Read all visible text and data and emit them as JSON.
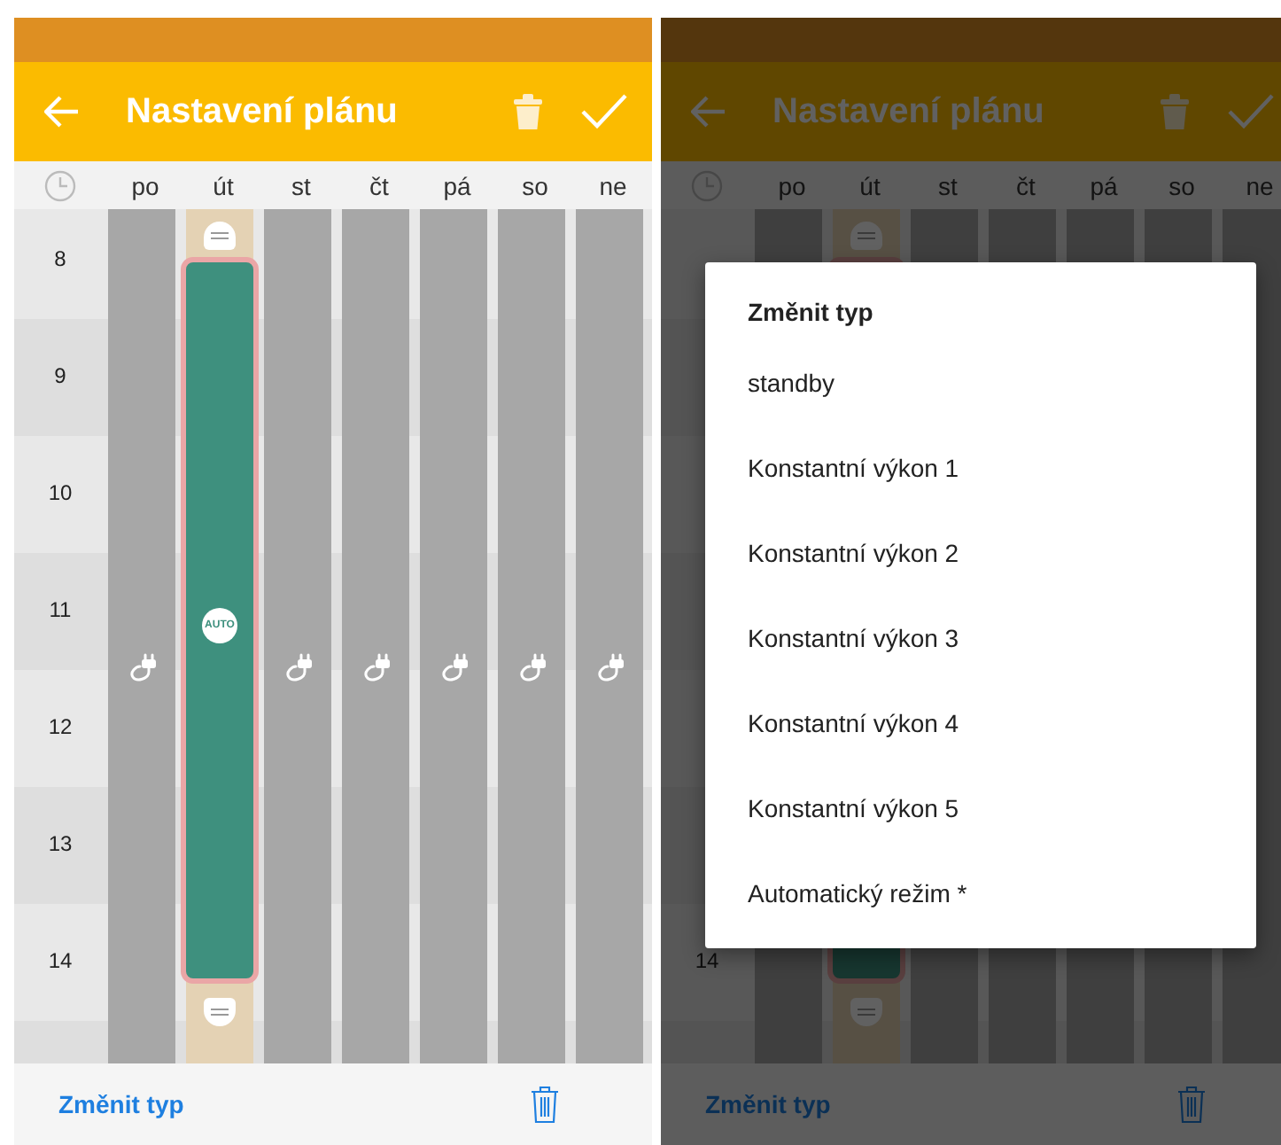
{
  "screens": [
    {
      "app_bar": {
        "title": "Nastavení plánu"
      },
      "days": [
        {
          "label": "po",
          "block": false
        },
        {
          "label": "út",
          "block": true
        },
        {
          "label": "st",
          "block": false
        },
        {
          "label": "čt",
          "block": false
        },
        {
          "label": "pá",
          "block": false
        },
        {
          "label": "so",
          "block": false
        },
        {
          "label": "ne",
          "block": false
        }
      ],
      "hours": [
        "8",
        "9",
        "10",
        "11",
        "12",
        "13",
        "14"
      ],
      "block_badge": "AUTO",
      "bottom_bar": {
        "action": "Změnit typ"
      },
      "dimmed": false
    },
    {
      "app_bar": {
        "title": "Nastavení plánu"
      },
      "days": [
        {
          "label": "po",
          "block": false
        },
        {
          "label": "út",
          "block": true
        },
        {
          "label": "st",
          "block": false
        },
        {
          "label": "čt",
          "block": false
        },
        {
          "label": "pá",
          "block": false
        },
        {
          "label": "so",
          "block": false
        },
        {
          "label": "ne",
          "block": false
        }
      ],
      "hours": [
        "14"
      ],
      "bottom_bar": {
        "action": "Změnit typ"
      },
      "dimmed": true,
      "dialog": {
        "title": "Změnit typ",
        "options": [
          "standby",
          "Konstantní výkon 1",
          "Konstantní výkon 2",
          "Konstantní výkon 3",
          "Konstantní výkon 4",
          "Konstantní výkon 5",
          "Automatický režim *"
        ]
      }
    }
  ]
}
